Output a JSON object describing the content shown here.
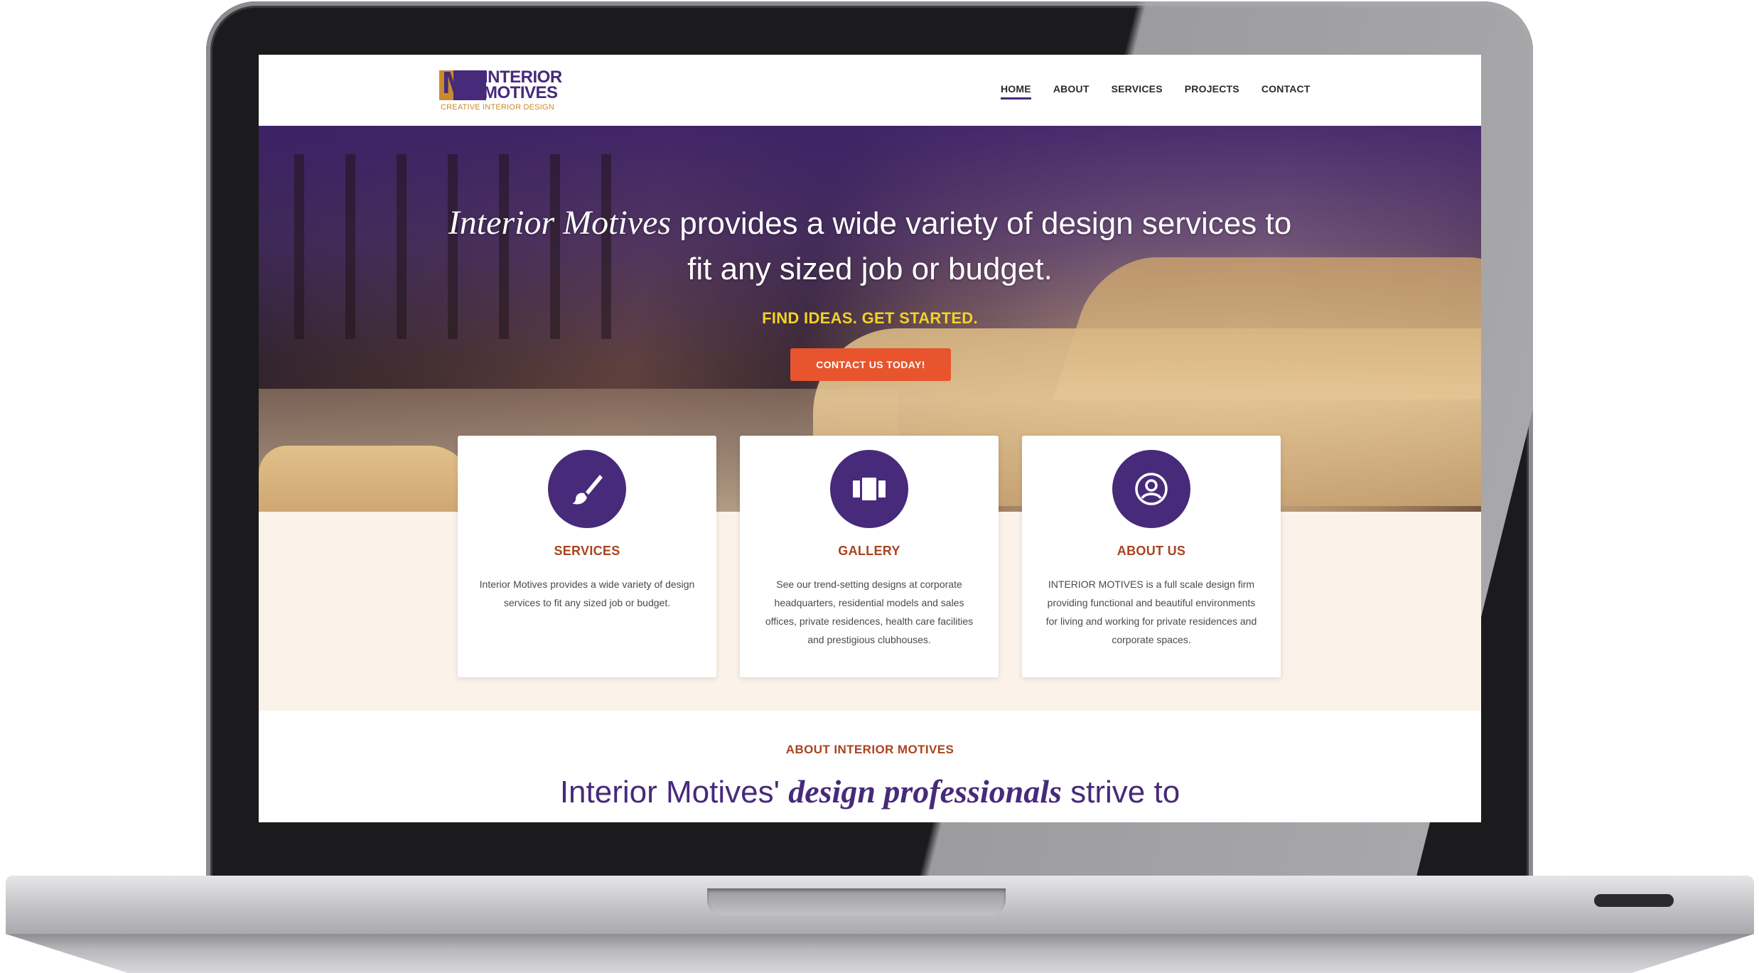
{
  "header": {
    "logo": {
      "mark": "M",
      "line1": "INTERIOR",
      "line2": "MOTIVES",
      "tagline": "CREATIVE INTERIOR DESIGN"
    },
    "nav": [
      {
        "label": "HOME",
        "active": true
      },
      {
        "label": "ABOUT",
        "active": false
      },
      {
        "label": "SERVICES",
        "active": false
      },
      {
        "label": "PROJECTS",
        "active": false
      },
      {
        "label": "CONTACT",
        "active": false
      }
    ]
  },
  "hero": {
    "title_emphasis": "Interior Motives",
    "title_rest": " provides a wide variety of design services to",
    "title_line2": "fit any sized job or budget.",
    "subtitle": "FIND IDEAS. GET STARTED.",
    "cta_label": "CONTACT US TODAY!"
  },
  "cards": [
    {
      "icon": "paintbrush-icon",
      "title": "SERVICES",
      "text": "Interior Motives provides a wide variety of design services to fit any sized job or budget."
    },
    {
      "icon": "gallery-icon",
      "title": "GALLERY",
      "text": "See our trend-setting designs at corporate headquarters, residential models and sales offices, private residences, health care facilities and prestigious clubhouses."
    },
    {
      "icon": "person-icon",
      "title": "ABOUT US",
      "text": "INTERIOR MOTIVES is a full scale design firm providing functional and beautiful environments for living and working for private residences and corporate spaces."
    }
  ],
  "about": {
    "label": "ABOUT INTERIOR MOTIVES",
    "heading_start": "Interior Motives' ",
    "heading_emphasis": "design professionals",
    "heading_end": " strive to"
  },
  "colors": {
    "brand_purple": "#472a7a",
    "accent_orange": "#e8542e",
    "accent_yellow": "#f2d323",
    "title_rust": "#a8441f",
    "band_cream": "#fbf3ea"
  }
}
